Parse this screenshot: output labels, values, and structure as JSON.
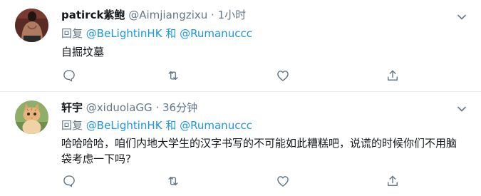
{
  "tweets": [
    {
      "name": "patirck紫鲍",
      "handle": "@Aimjiangzixu",
      "separator": "·",
      "time": "1小时",
      "reply_prefix": "回复",
      "reply_mention_1": "@BeLightinHK",
      "reply_and": "和",
      "reply_mention_2": "@Rumanuccc",
      "text": "自掘坟墓",
      "avatar_icon": "avatar-shirtless-man",
      "actions": [
        "reply-icon",
        "retweet-icon",
        "like-icon",
        "share-icon"
      ]
    },
    {
      "name": "轩宇",
      "handle": "@xiduolaGG",
      "separator": "·",
      "time": "36分钟",
      "reply_prefix": "回复",
      "reply_mention_1": "@BeLightinHK",
      "reply_and": "和",
      "reply_mention_2": "@Rumanuccc",
      "text": "哈哈哈哈，咱们内地大学生的汉字书写的不可能如此糟糕吧，说谎的时候你们不用脑袋考虑一下吗?",
      "avatar_icon": "avatar-cat",
      "actions": [
        "reply-icon",
        "retweet-icon",
        "like-icon",
        "share-icon"
      ]
    }
  ],
  "colors": {
    "accent": "#1b95e0",
    "secondary": "#657786",
    "divider": "#e6ecf0"
  }
}
